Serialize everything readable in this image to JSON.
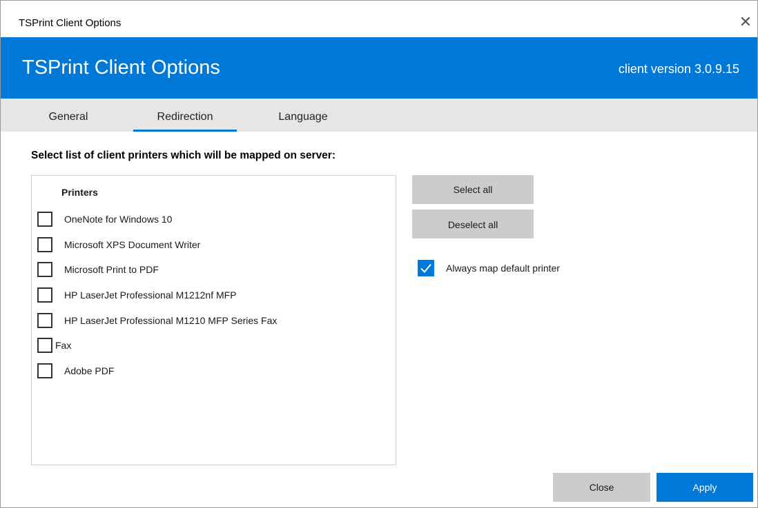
{
  "window": {
    "title": "TSPrint Client Options",
    "close_glyph": "✕"
  },
  "banner": {
    "title": "TSPrint Client Options",
    "version": "client version 3.0.9.15",
    "color": "#0078d7"
  },
  "tabs": [
    {
      "label": "General",
      "active": false
    },
    {
      "label": "Redirection",
      "active": true
    },
    {
      "label": "Language",
      "active": false
    }
  ],
  "main": {
    "heading": "Select list of client printers which will be mapped on server:",
    "list_header": "Printers",
    "printers": [
      {
        "label": "OneNote for Windows 10",
        "checked": false
      },
      {
        "label": "Microsoft XPS Document Writer",
        "checked": false
      },
      {
        "label": "Microsoft Print to PDF",
        "checked": false
      },
      {
        "label": "HP LaserJet Professional M1212nf MFP",
        "checked": false
      },
      {
        "label": "HP LaserJet Professional M1210 MFP Series Fax",
        "checked": false
      },
      {
        "label": "Fax",
        "checked": false
      },
      {
        "label": "Adobe PDF",
        "checked": false
      }
    ],
    "select_all_label": "Select all",
    "deselect_all_label": "Deselect all",
    "always_map": {
      "label": "Always map default printer",
      "checked": true
    }
  },
  "footer": {
    "close_label": "Close",
    "apply_label": "Apply"
  },
  "icons": {
    "close": "close-icon",
    "check": "checkmark-icon"
  }
}
